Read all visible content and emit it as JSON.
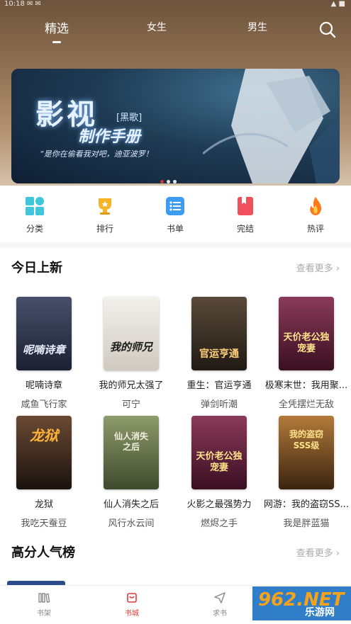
{
  "status": {
    "left": "10:18 ✉ ✉",
    "right": "▲ ■"
  },
  "top_tabs": [
    {
      "label": "精选",
      "active": true
    },
    {
      "label": "女生",
      "active": false
    },
    {
      "label": "男生",
      "active": false
    }
  ],
  "banner": {
    "title": "影视",
    "tag": "[黑歌]",
    "subtitle": "制作手册",
    "quote": "“是你在偷看我对吧，迪亚波罗！",
    "page_count": 3,
    "active_page": 1
  },
  "categories": [
    {
      "label": "分类",
      "icon": "grid-icon"
    },
    {
      "label": "排行",
      "icon": "trophy-icon"
    },
    {
      "label": "书单",
      "icon": "list-icon"
    },
    {
      "label": "完结",
      "icon": "bookmark-icon"
    },
    {
      "label": "热评",
      "icon": "flame-icon"
    }
  ],
  "new_today": {
    "title": "今日上新",
    "more": "查看更多 ›",
    "books": [
      {
        "name": "呢喃诗章",
        "author": "咸鱼飞行家",
        "cover_text": "呢喃诗章",
        "bg": "#2b3244"
      },
      {
        "name": "我的师兄太强了",
        "author": "可宁",
        "cover_text": "我的师兄",
        "bg": "#e9e6df"
      },
      {
        "name": "重生：官运亨通",
        "author": "弹剑听潮",
        "cover_text": "官运亨通",
        "bg": "#3a3024"
      },
      {
        "name": "极寒末世：我用聚...",
        "author": "全凭摆烂无敌",
        "cover_text": "天价老公独宠妻",
        "bg": "#5a1e3a"
      },
      {
        "name": "龙狱",
        "author": "我吃天蚕豆",
        "cover_text": "龙狱",
        "bg": "#3b2a22"
      },
      {
        "name": "仙人消失之后",
        "author": "风行水云间",
        "cover_text": "仙人消失之后",
        "bg": "#6a7a4e"
      },
      {
        "name": "火影之最强势力",
        "author": "燃烬之手",
        "cover_text": "天价老公独宠妻",
        "bg": "#5a1e3a"
      },
      {
        "name": "网游：我的盗窃SS...",
        "author": "我是胖蓝猫",
        "cover_text": "我的盗窃SSS级",
        "bg": "#7a4a1e"
      }
    ]
  },
  "popular": {
    "title": "高分人气榜",
    "more": "查看更多 ›"
  },
  "bottom_nav": [
    {
      "label": "书架",
      "active": false
    },
    {
      "label": "书城",
      "active": true
    },
    {
      "label": "求书",
      "active": false
    }
  ],
  "watermark": {
    "big": "962.NET",
    "small": "乐游网"
  },
  "colors": {
    "accent": "#e53935",
    "hero_top": "#6e543c",
    "muted": "#aaaaaa"
  }
}
